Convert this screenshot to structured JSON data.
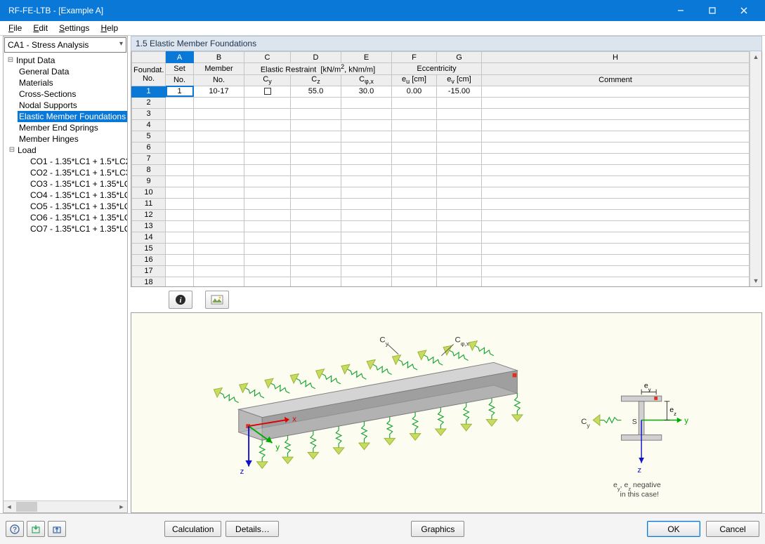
{
  "window": {
    "title": "RF-FE-LTB - [Example A]"
  },
  "menu": {
    "file": "File",
    "edit": "Edit",
    "settings": "Settings",
    "help": "Help"
  },
  "case_combo": "CA1 - Stress Analysis",
  "tree": {
    "input_data": "Input Data",
    "items": [
      "General Data",
      "Materials",
      "Cross-Sections",
      "Nodal Supports",
      "Elastic Member Foundations",
      "Member End Springs",
      "Member Hinges"
    ],
    "selected_index": 4,
    "load": "Load",
    "loads": [
      "CO1 - 1.35*LC1 + 1.5*LC2",
      "CO2 - 1.35*LC1 + 1.5*LC3",
      "CO3 - 1.35*LC1 + 1.35*LC",
      "CO4 - 1.35*LC1 + 1.35*LC",
      "CO5 - 1.35*LC1 + 1.35*LC",
      "CO6 - 1.35*LC1 + 1.35*LC",
      "CO7 - 1.35*LC1 + 1.35*LC"
    ]
  },
  "section_title": "1.5 Elastic Member Foundations",
  "grid": {
    "letters": [
      "A",
      "B",
      "C",
      "D",
      "E",
      "F",
      "G",
      "H"
    ],
    "header1": {
      "foundat_no": "Foundat. No.",
      "set": "Set",
      "member": "Member",
      "elastic_restraint": "Elastic Restraint  [kN/m², kNm/m]",
      "eccentricity": "Eccentricity",
      "comment_col": ""
    },
    "header2": {
      "set_no": "No.",
      "member_no": "No.",
      "cy": "Cᵧ",
      "cz": "C_z",
      "cphix": "C_φ,x",
      "eu": "eᵤ [cm]",
      "ev": "eᵥ [cm]",
      "comment": "Comment"
    },
    "rows": 18,
    "data_row": {
      "no": "1",
      "set": "1",
      "member": "10-17",
      "cz": "55.0",
      "cphix": "30.0",
      "eu": "0.00",
      "ev": "-15.00"
    }
  },
  "diagram": {
    "cy_label": "Cy",
    "cphix_label": "Cφ,x",
    "x": "x",
    "y": "y",
    "z": "z",
    "ey": "eᵧ",
    "ez": "e_z",
    "s": "S",
    "note1": "eᵧ, e_z negative",
    "note2": "in this case!"
  },
  "buttons": {
    "calculation": "Calculation",
    "details": "Details…",
    "graphics": "Graphics",
    "ok": "OK",
    "cancel": "Cancel"
  }
}
